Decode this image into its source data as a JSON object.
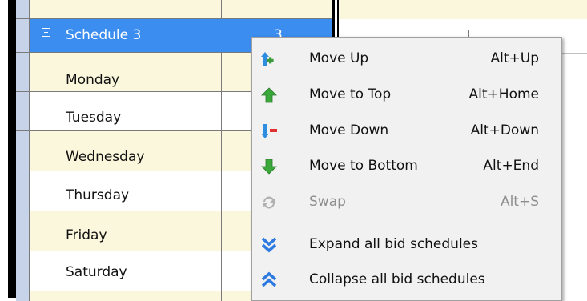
{
  "grid": {
    "schedule_row": {
      "label": "Schedule 3",
      "value": "3"
    },
    "day_rows": [
      "Monday",
      "Tuesday",
      "Wednesday",
      "Thursday",
      "Friday",
      "Saturday"
    ]
  },
  "context_menu": {
    "items": [
      {
        "label": "Move Up",
        "shortcut": "Alt+Up",
        "icon": "move-up-icon",
        "enabled": true
      },
      {
        "label": "Move to Top",
        "shortcut": "Alt+Home",
        "icon": "move-to-top-icon",
        "enabled": true
      },
      {
        "label": "Move Down",
        "shortcut": "Alt+Down",
        "icon": "move-down-icon",
        "enabled": true
      },
      {
        "label": "Move to Bottom",
        "shortcut": "Alt+End",
        "icon": "move-to-bottom-icon",
        "enabled": true
      },
      {
        "label": "Swap",
        "shortcut": "Alt+S",
        "icon": "swap-icon",
        "enabled": false
      },
      {
        "label": "Expand all bid schedules",
        "shortcut": "",
        "icon": "expand-all-icon",
        "enabled": true
      },
      {
        "label": "Collapse all bid schedules",
        "shortcut": "",
        "icon": "collapse-all-icon",
        "enabled": true
      }
    ]
  },
  "colors": {
    "selection": "#3b8df0",
    "row_cream": "#fbf7dc",
    "up_arrow": "#3c9a3c",
    "down_arrow": "#e03030",
    "chevron": "#2f7ae0"
  }
}
